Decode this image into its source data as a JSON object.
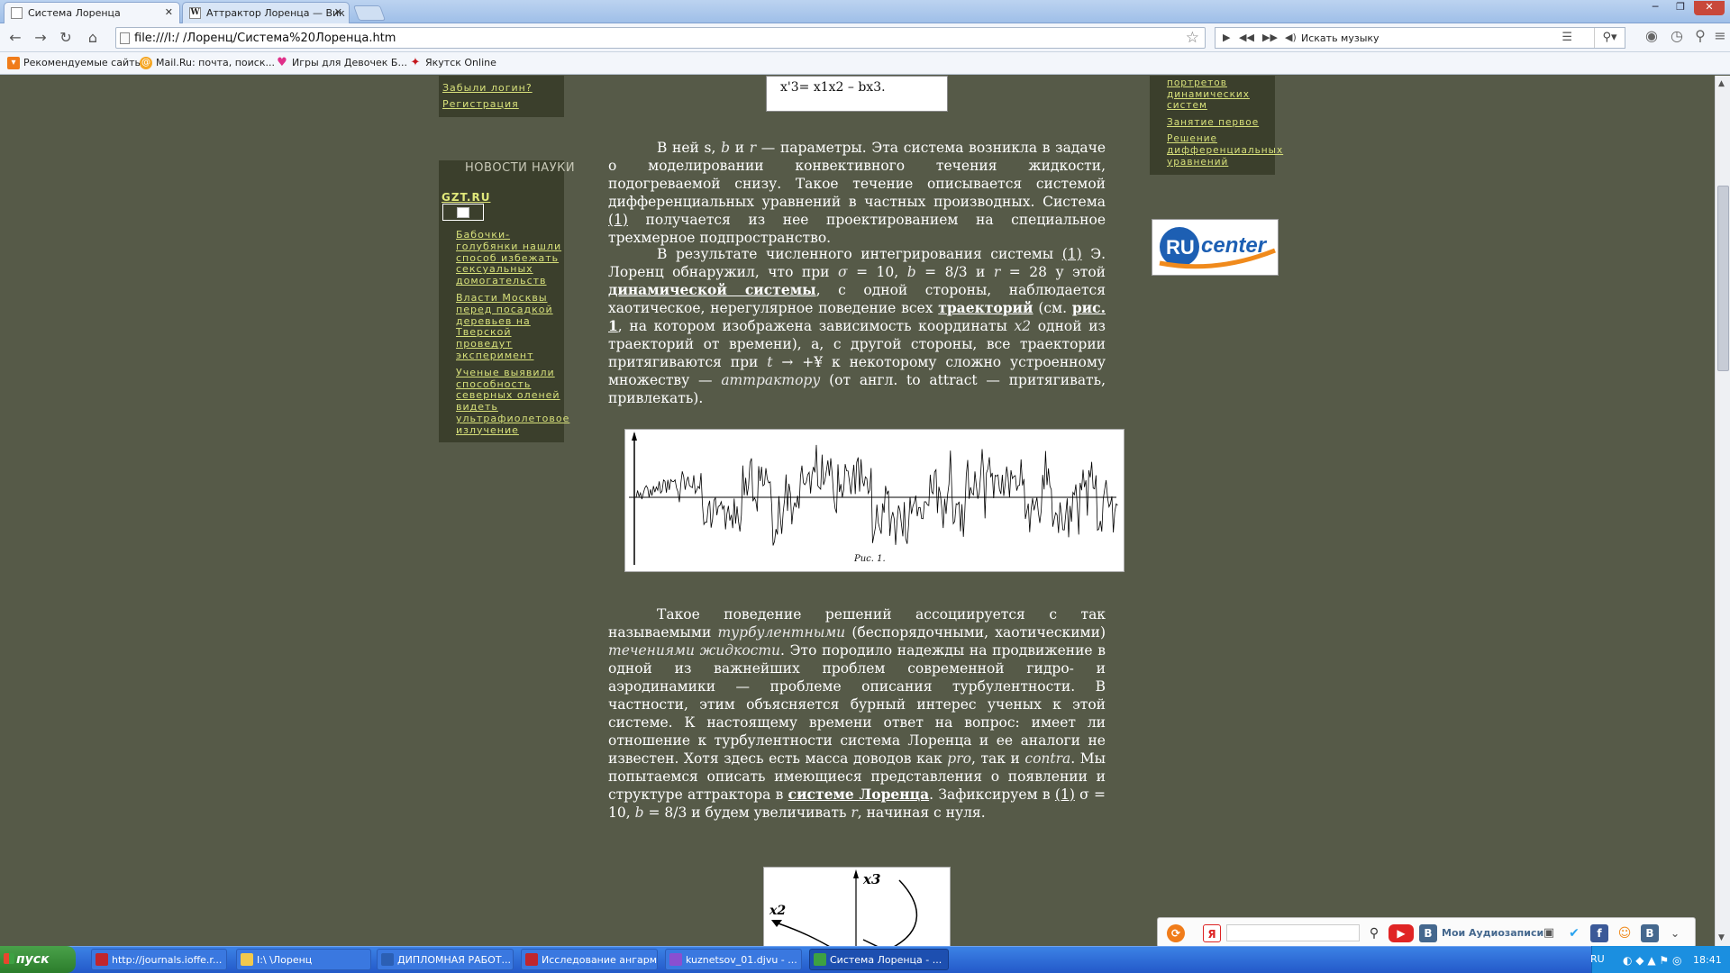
{
  "tabs": [
    {
      "title": "Система Лоренца",
      "favicon": "page-icon"
    },
    {
      "title": "Аттрактор Лоренца — Вик",
      "favicon": "wikipedia-icon"
    }
  ],
  "address": {
    "url": "file:///I:/ /Лоренц/Система%20Лоренца.htm"
  },
  "music_search": {
    "placeholder": "Искать музыку"
  },
  "bookmarks": [
    {
      "label": "Рекомендуемые сайты",
      "icon": "recommend-icon",
      "color": "#f07c1a"
    },
    {
      "label": "Mail.Ru: почта, поиск...",
      "icon": "mailru-icon",
      "color": "#f5a623"
    },
    {
      "label": "Игры для Девочек Б...",
      "icon": "heart-icon",
      "color": "#e0308a"
    },
    {
      "label": "Якутск Online",
      "icon": "yakutsk-icon",
      "color": "#c4161c"
    }
  ],
  "left": {
    "links": [
      "Забыли логин?",
      "Регистрация"
    ],
    "news_title": "НОВОСТИ НАУКИ",
    "gzt": "GZT.RU",
    "news": [
      [
        "Бабочки-",
        "голубянки нашли",
        "способ избежать",
        "сексуальных",
        "домогательств"
      ],
      [
        "Власти Москвы",
        "перед посадкой",
        "деревьев на",
        "Тверской",
        "проведут",
        "эксперимент"
      ],
      [
        "Ученые выявили",
        "способность",
        "северных оленей",
        "видеть",
        "ультрафиолетовое",
        "излучение"
      ]
    ]
  },
  "right": {
    "links": [
      [
        "портретов",
        "динамических",
        "систем"
      ],
      [
        "Занятие первое"
      ],
      [
        "Решение",
        "дифференциальных",
        "уравнений"
      ]
    ],
    "banner": {
      "ru": "RU",
      "center": "center"
    }
  },
  "formula": "x'3= x1x2 – bx3.",
  "paragraphs": {
    "p1": [
      {
        "t": "В ней s, "
      },
      {
        "t": "b",
        "i": true
      },
      {
        "t": " и "
      },
      {
        "t": "r",
        "i": true
      },
      {
        "t": " — параметры. Эта система возникла в задаче о моделировании конвективного течения жидкости, подогреваемой снизу. Такое течение описывается системой дифференциальных уравнений в частных производных. Система "
      },
      {
        "t": "(1)",
        "u": true
      },
      {
        "t": " получается из нее проектированием на специальное трехмерное подпространство."
      }
    ],
    "p2": [
      {
        "t": "В результате численного интегрирования системы "
      },
      {
        "t": "(1)",
        "u": true
      },
      {
        "t": " Э. Лоренц обнаружил, что при "
      },
      {
        "t": "σ",
        "i": true
      },
      {
        "t": " = 10, "
      },
      {
        "t": "b",
        "i": true
      },
      {
        "t": " = 8/3 и "
      },
      {
        "t": "r",
        "i": true
      },
      {
        "t": " = 28 у этой "
      },
      {
        "t": "динамической системы",
        "u": true,
        "b": true
      },
      {
        "t": ", с одной стороны, наблюдается хаотическое, нерегулярное поведение всех "
      },
      {
        "t": "траекторий",
        "u": true,
        "b": true
      },
      {
        "t": " (см. "
      },
      {
        "t": "рис. 1",
        "u": true,
        "b": true
      },
      {
        "t": ", на котором изображена зависимость координаты "
      },
      {
        "t": "x2",
        "i": true
      },
      {
        "t": " одной из траекторий от времени), а, с другой стороны, все траектории притягиваются при "
      },
      {
        "t": "t",
        "i": true
      },
      {
        "t": " → +¥ к некоторому сложно устроенному множеству — "
      },
      {
        "t": "аттрактору",
        "i": true
      },
      {
        "t": " (от англ. to attract — притягивать, привлекать)."
      }
    ],
    "p3": [
      {
        "t": "Такое поведение решений ассоциируется с так называемыми "
      },
      {
        "t": "турбулентными",
        "i": true
      },
      {
        "t": " (беспорядочными, хаотическими) "
      },
      {
        "t": "течениями жидкости",
        "i": true
      },
      {
        "t": ". Это породило надежды на продвижение в одной из важнейших проблем современной гидро- и аэродинамики — проблеме описания турбулентности. В частности, этим объясняется бурный интерес ученых к этой системе. К настоящему времени ответ на вопрос: имеет ли отношение к турбулентности система Лоренца и ее аналоги не известен. Хотя здесь есть масса доводов как "
      },
      {
        "t": "pro",
        "i": true
      },
      {
        "t": ", так и "
      },
      {
        "t": "contra",
        "i": true
      },
      {
        "t": ". Мы попытаемся описать имеющиеся представления о появлении и структуре аттрактора в "
      },
      {
        "t": "системе Лоренца",
        "u": true,
        "b": true
      },
      {
        "t": ". Зафиксируем в "
      },
      {
        "t": "(1)",
        "u": true
      },
      {
        "t": " σ = 10, "
      },
      {
        "t": "b",
        "i": true
      },
      {
        "t": " = 8/3 и будем увеличивать "
      },
      {
        "t": "r",
        "i": true
      },
      {
        "t": ", начиная с нуля."
      }
    ]
  },
  "figure1": {
    "caption": "Рис. 1."
  },
  "figure2": {
    "x3": "x3",
    "x2": "x2"
  },
  "yandex_bar": {
    "audio_label": "Мои Аудиозаписи",
    "y": "Я"
  },
  "taskbar": {
    "start": "пуск",
    "tasks": [
      {
        "label": "http://journals.ioffe.r...",
        "color": "#c0262d"
      },
      {
        "label": "I:\\ \\Лоренц",
        "color": "#f2c94c"
      },
      {
        "label": "ДИПЛОМНАЯ РАБОТ...",
        "color": "#2b5fb4"
      },
      {
        "label": "Исследование ангарм осилля...",
        "color": "#c0262d"
      },
      {
        "label": "kuznetsov_01.djvu - ...",
        "color": "#8a4fd0"
      },
      {
        "label": "Система Лоренца - ...",
        "color": "#3da142"
      }
    ],
    "lang": "RU",
    "clock": "18:41"
  }
}
